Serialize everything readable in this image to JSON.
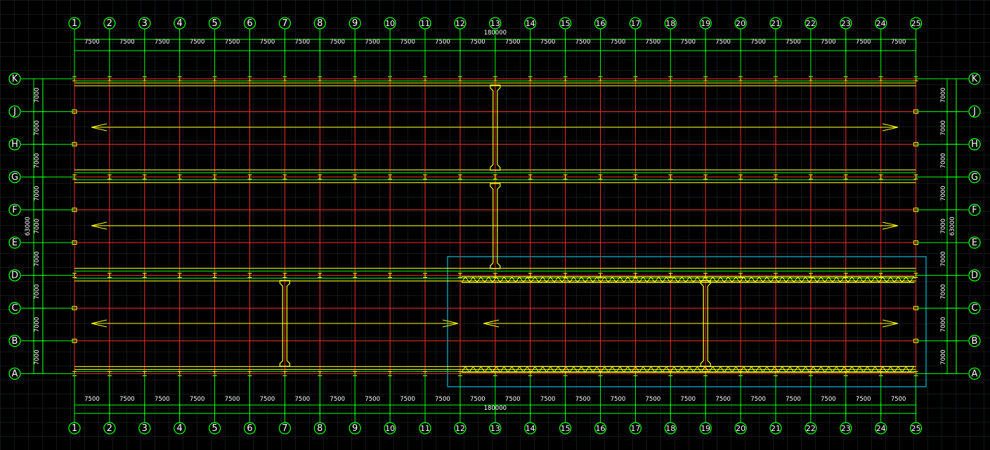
{
  "colors": {
    "background": "#000000",
    "cad_grid": "#262c30",
    "axis_lines": "#ff2a2a",
    "dimension_and_bubbles": "#00ff00",
    "crane_rails_and_trusses": "#ffff00",
    "section_frame": "#00e5ff"
  },
  "axes": {
    "columns": [
      "1",
      "2",
      "3",
      "4",
      "5",
      "6",
      "7",
      "8",
      "9",
      "10",
      "11",
      "12",
      "13",
      "14",
      "15",
      "16",
      "17",
      "18",
      "19",
      "20",
      "21",
      "22",
      "23",
      "24",
      "25"
    ],
    "rows": [
      "K",
      "J",
      "H",
      "G",
      "F",
      "E",
      "D",
      "C",
      "B",
      "A"
    ]
  },
  "dims": {
    "bay": "7500",
    "total": "180000",
    "row_bay": "7000",
    "total_rows": "63000"
  },
  "shapes": {
    "crane_arrows": "double-headed arrows",
    "crane_beams": "I-shaped runway beams",
    "trusses": "zig-zag truss bands"
  }
}
